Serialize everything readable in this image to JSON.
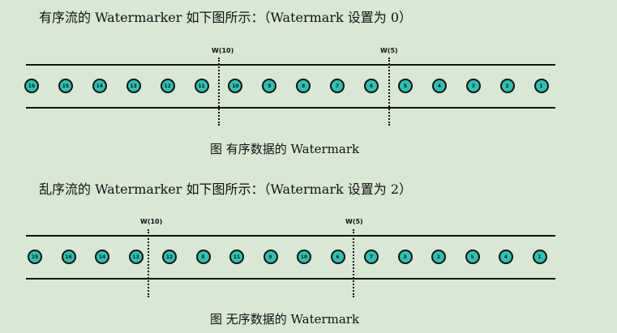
{
  "top": {
    "description": "有序流的 Watermarker 如下图所示：（Watermark 设置为 0）",
    "watermarks": [
      "W(10)",
      "W(5)"
    ],
    "events": [
      "16",
      "15",
      "14",
      "13",
      "12",
      "11",
      "10",
      "9",
      "8",
      "7",
      "6",
      "5",
      "4",
      "3",
      "2",
      "1"
    ],
    "caption": "图  有序数据的 Watermark"
  },
  "bottom": {
    "description": "乱序流的 Watermarker 如下图所示：（Watermark 设置为 2）",
    "watermarks": [
      "W(10)",
      "W(5)"
    ],
    "events": [
      "15",
      "16",
      "14",
      "13",
      "12",
      "8",
      "11",
      "9",
      "10",
      "6",
      "7",
      "3",
      "2",
      "5",
      "4",
      "1"
    ],
    "caption": "图  无序数据的 Watermark"
  }
}
